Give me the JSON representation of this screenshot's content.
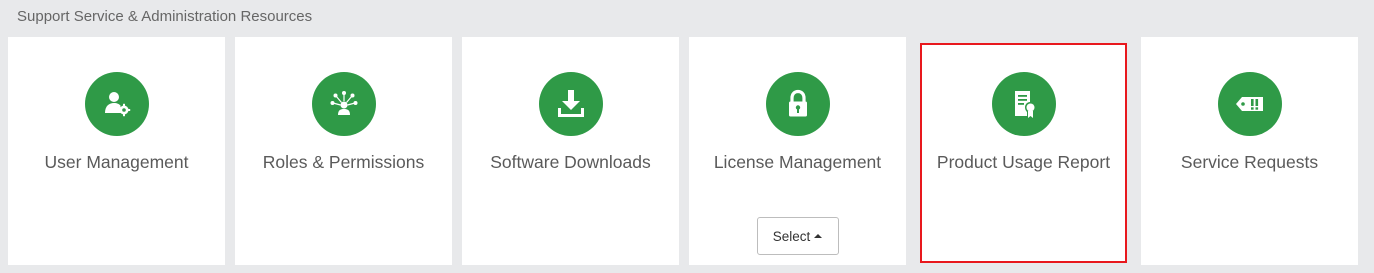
{
  "section": {
    "title": "Support Service & Administration Resources"
  },
  "tiles": [
    {
      "label": "User Management",
      "icon": "user-gear-icon"
    },
    {
      "label": "Roles & Permissions",
      "icon": "roles-network-icon"
    },
    {
      "label": "Software Downloads",
      "icon": "download-icon"
    },
    {
      "label": "License Management",
      "icon": "lock-icon",
      "button_label": "Select"
    },
    {
      "label": "Product Usage Report",
      "icon": "certificate-report-icon",
      "highlighted": true
    },
    {
      "label": "Service Requests",
      "icon": "ticket-alert-icon"
    }
  ],
  "colors": {
    "icon_background": "#2f9a47",
    "highlight_border": "#e8181d",
    "page_background": "#e8e9eb"
  }
}
